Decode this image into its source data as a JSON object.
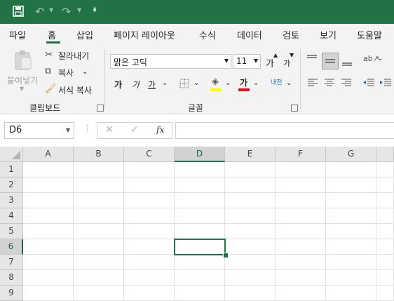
{
  "qat": {
    "save": "save-icon",
    "undo": "undo-icon",
    "redo": "redo-icon",
    "customize": "customize-icon"
  },
  "tabs": [
    "파일",
    "홈",
    "삽입",
    "페이지 레이아웃",
    "수식",
    "데이터",
    "검토",
    "보기",
    "도움말"
  ],
  "clipboard": {
    "paste": "붙여넣기",
    "cut": "잘라내기",
    "copy": "복사",
    "format_painter": "서식 복사",
    "group": "클립보드"
  },
  "font": {
    "name": "맑은 고딕",
    "size": "11",
    "grow": "가",
    "shrink": "가",
    "bold": "가",
    "italic": "가",
    "underline": "가",
    "fill_color": "#ffff00",
    "font_color_glyph": "가",
    "font_color": "#e81123",
    "phonetic": "내천",
    "group": "글꼴"
  },
  "formula_bar": {
    "cell_ref": "D6",
    "cancel": "✕",
    "enter": "✓",
    "fx": "fx",
    "value": ""
  },
  "columns": [
    "A",
    "B",
    "C",
    "D",
    "E",
    "F",
    "G"
  ],
  "rows": [
    "1",
    "2",
    "3",
    "4",
    "5",
    "6",
    "7",
    "8",
    "9"
  ],
  "active": {
    "col": "D",
    "row": "6"
  }
}
